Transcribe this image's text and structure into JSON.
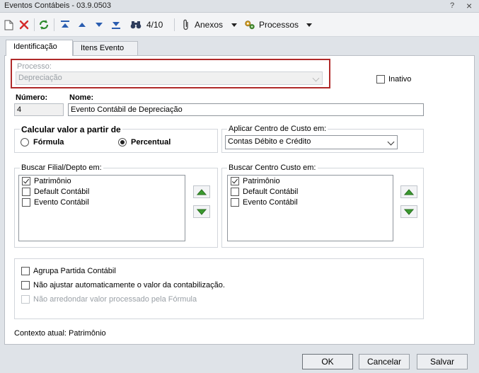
{
  "window": {
    "title": "Eventos Contábeis - 03.9.0503",
    "help": "?",
    "close": "×"
  },
  "toolbar": {
    "record_counter": "4/10",
    "anexos_label": "Anexos",
    "processos_label": "Processos"
  },
  "tabs": [
    {
      "label": "Identificação",
      "active": true
    },
    {
      "label": "Itens Evento",
      "active": false
    }
  ],
  "form": {
    "processo_label": "Processo:",
    "processo_value": "Depreciação",
    "inativo_label": "Inativo",
    "inativo_checked": false,
    "numero_label": "Número:",
    "numero_value": "4",
    "nome_label": "Nome:",
    "nome_value": "Evento Contábil de Depreciação",
    "calcular_title": "Calcular valor a partir de",
    "radio_formula": "Fórmula",
    "radio_percentual": "Percentual",
    "selected_radio": "Percentual",
    "aplicar_title": "Aplicar Centro de Custo em:",
    "aplicar_value": "Contas Débito e Crédito",
    "buscar_filial_title": "Buscar Filial/Depto em:",
    "buscar_filial_items": [
      {
        "label": "Patrimônio",
        "checked": true
      },
      {
        "label": "Default Contábil",
        "checked": false
      },
      {
        "label": "Evento Contábil",
        "checked": false
      }
    ],
    "buscar_cc_title": "Buscar Centro Custo em:",
    "buscar_cc_items": [
      {
        "label": "Patrimônio",
        "checked": true
      },
      {
        "label": "Default Contábil",
        "checked": false
      },
      {
        "label": "Evento Contábil",
        "checked": false
      }
    ],
    "opt_agrupa": "Agrupa Partida Contábil",
    "opt_nao_ajustar": "Não ajustar automaticamente o valor da contabilização.",
    "opt_nao_arredondar": "Não arredondar valor processado pela Fórmula",
    "contexto": "Contexto atual: Patrimônio"
  },
  "buttons": {
    "ok": "OK",
    "cancelar": "Cancelar",
    "salvar": "Salvar"
  },
  "colors": {
    "highlight": "#b02a2a",
    "arrow_green": "#3a9a2f"
  }
}
